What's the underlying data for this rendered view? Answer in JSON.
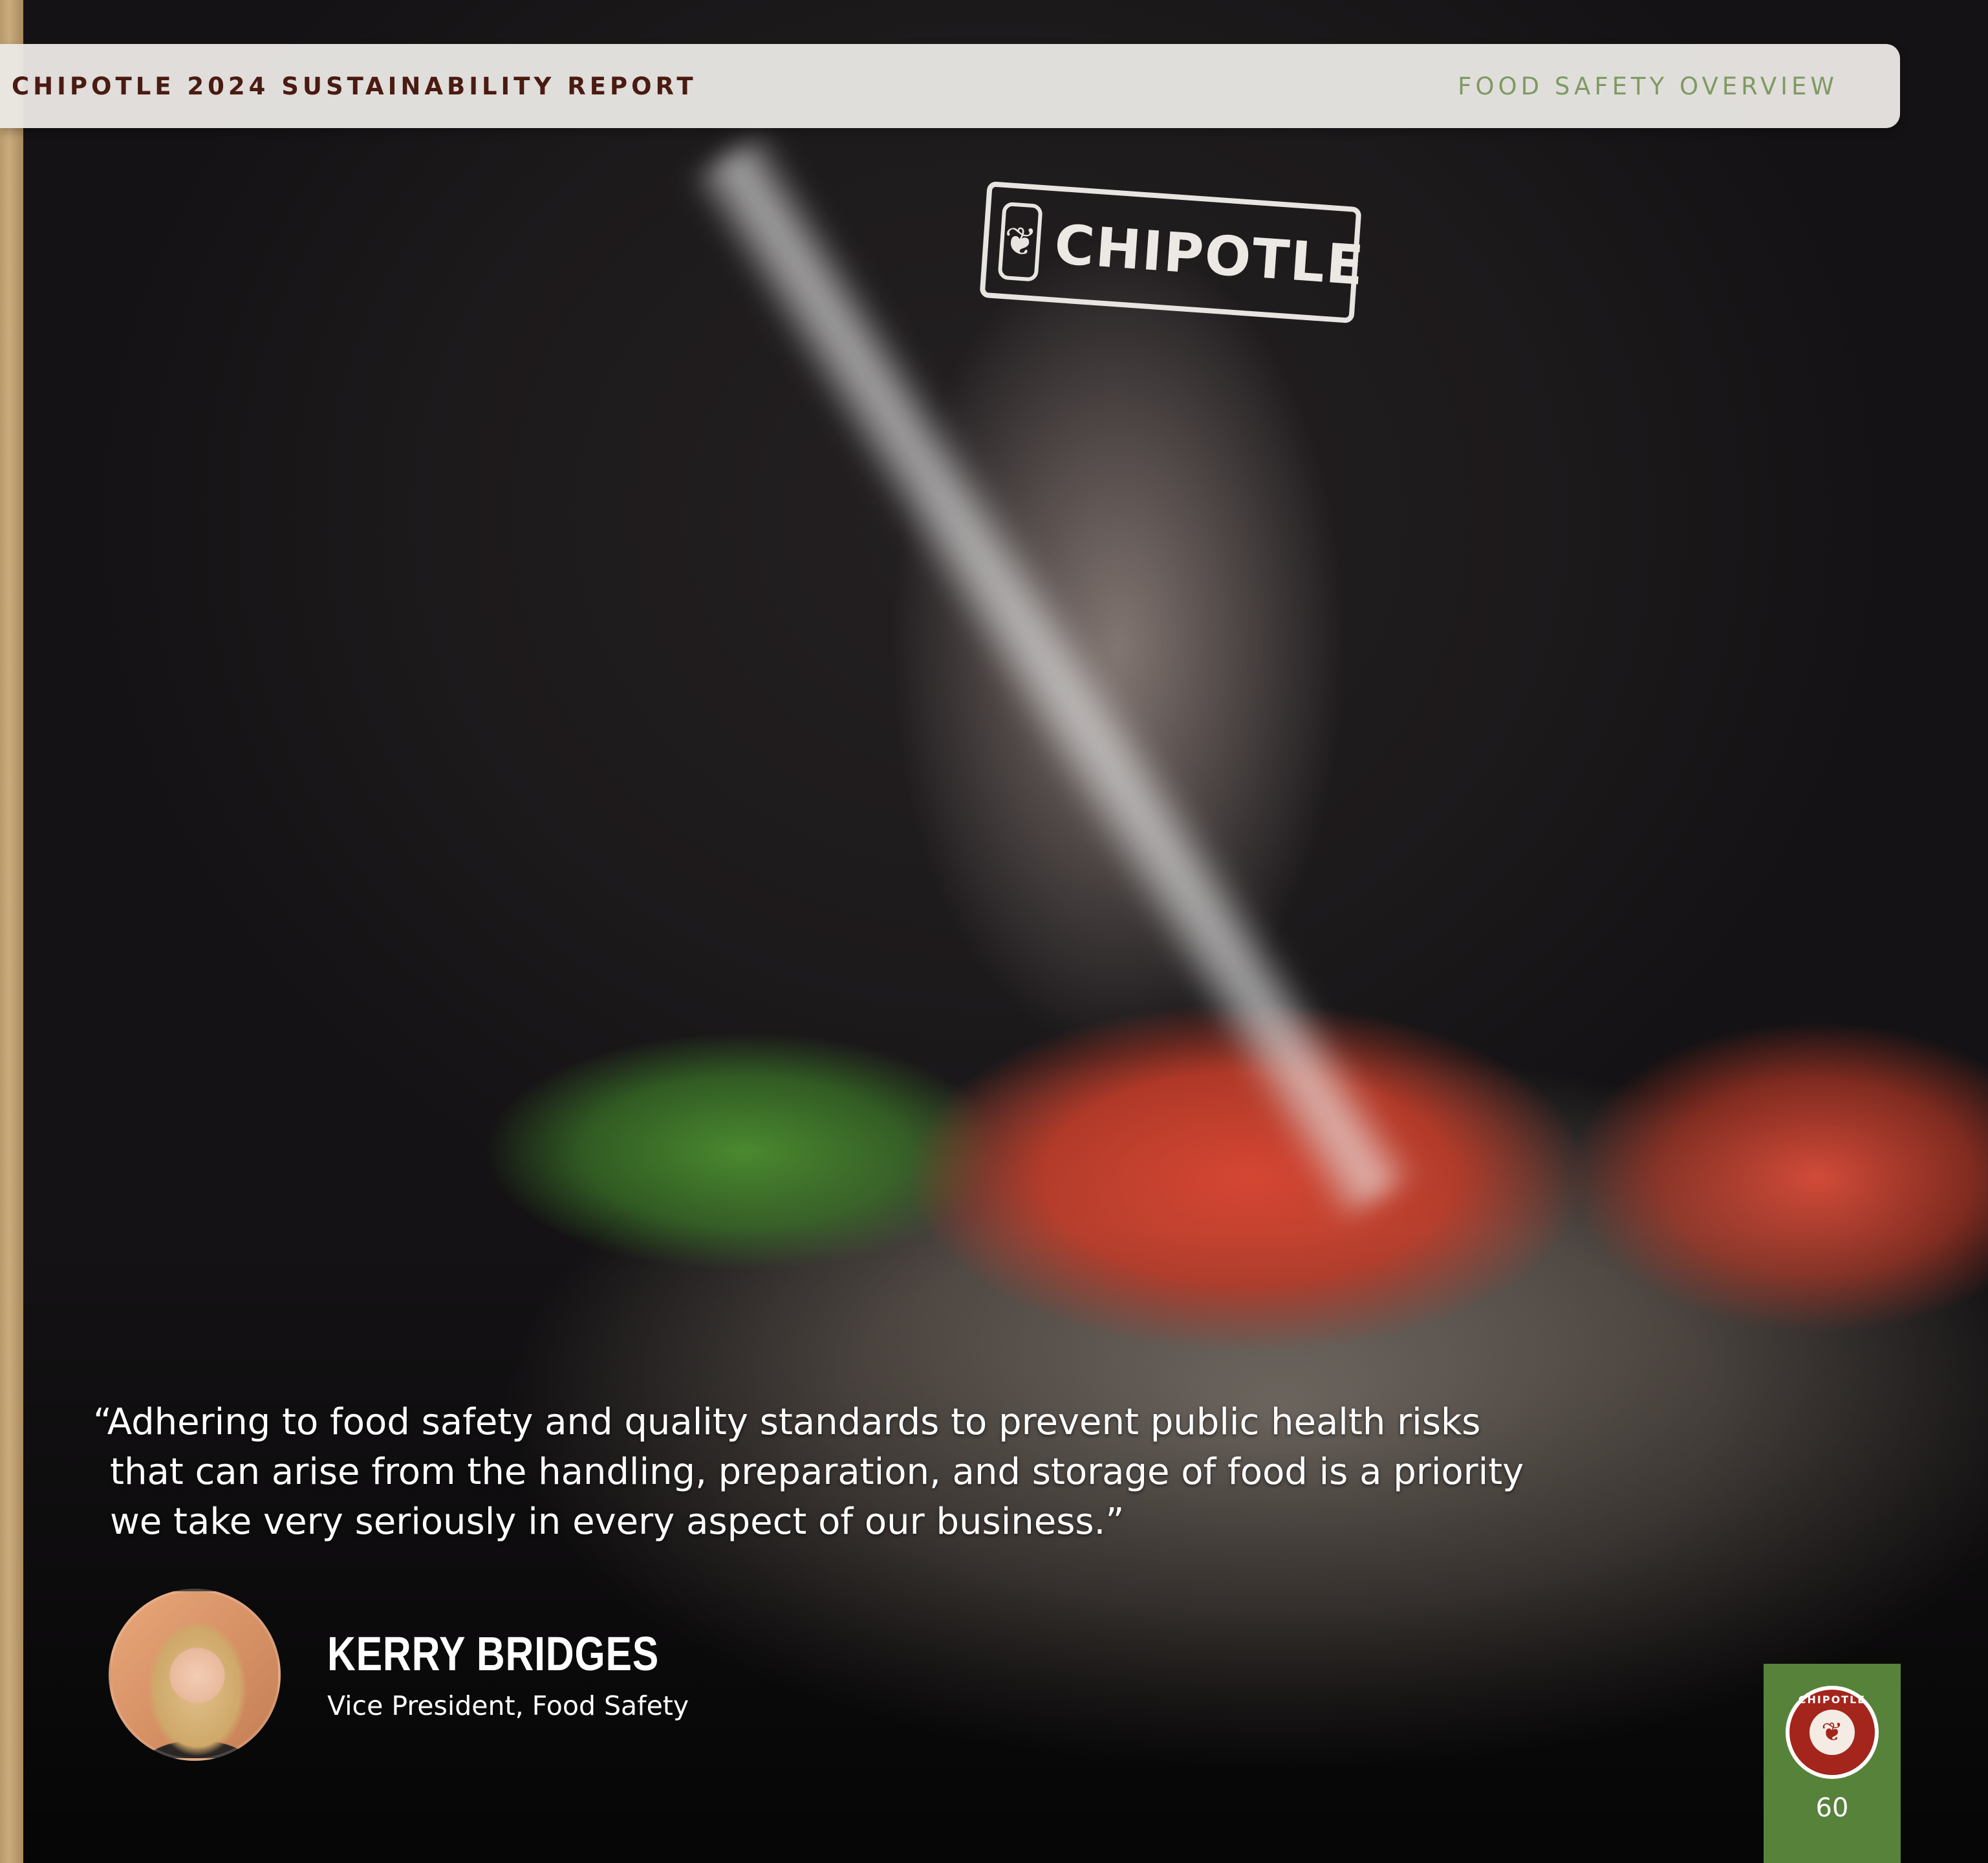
{
  "header": {
    "report_title": "CHIPOTLE 2024 SUSTAINABILITY REPORT",
    "section_title": "FOOD SAFETY OVERVIEW"
  },
  "photo": {
    "shirt_logo_text": "CHIPOTLE"
  },
  "quote": {
    "text": "“Adhering to food safety and quality standards to prevent public health risks that can arise from the handling, preparation, and storage of food is a priority we take very seriously in every aspect of our business.”"
  },
  "speaker": {
    "name": "KERRY BRIDGES",
    "role": "Vice President, Food Safety"
  },
  "page_tab": {
    "seal_text": "CHIPOTLE",
    "page_number": "60",
    "background_color": "#56823a"
  },
  "colors": {
    "header_title": "#4a1b12",
    "header_section": "#7f9a62",
    "seal_red": "#a3251c"
  }
}
